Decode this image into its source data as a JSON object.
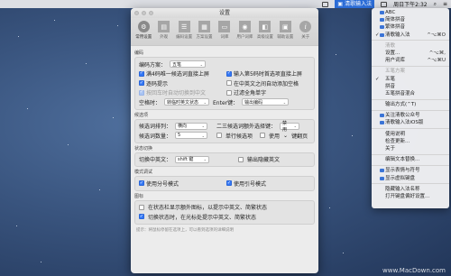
{
  "menubar": {
    "ime_label": "清歌输入法",
    "datetime": "周日下午2:32"
  },
  "window": {
    "title": "设置",
    "toolbar": [
      {
        "label": "常用设置",
        "icon": "gear-icon"
      },
      {
        "label": "外观",
        "icon": "book-icon"
      },
      {
        "label": "编码设置",
        "icon": "list-icon"
      },
      {
        "label": "方案设置",
        "icon": "grid-icon"
      },
      {
        "label": "词库",
        "icon": "words-icon"
      },
      {
        "label": "用户词库",
        "icon": "user-icon"
      },
      {
        "label": "高级设置",
        "icon": "advanced-icon"
      },
      {
        "label": "辅助设置",
        "icon": "gift-icon"
      },
      {
        "label": "关于",
        "icon": "info-icon"
      }
    ],
    "sections": {
      "encoding": {
        "title": "编码",
        "scheme_label": "编码方案：",
        "scheme_value": "五笔",
        "opt1": "满4码唯一候选词直接上屏",
        "opt2": "输入第5码时首选项直接上屏",
        "opt3": "逐码提示",
        "opt4": "在中英文之间自动添加空格",
        "opt5": "按回车时自动切换到中文",
        "opt6": "过滤全角单字",
        "space_label": "空格时：",
        "space_value": "转临时英文状态",
        "enter_label": "Enter键：",
        "enter_value": "输出编码"
      },
      "candidates": {
        "title": "候选项",
        "arrange_label": "候选词排列：",
        "arrange_value": "横向",
        "second_label": "二三候选词额外选择键：",
        "second_value": "禁用",
        "count_label": "候选词数量：",
        "count_value": "5",
        "single_row": "单行候选项",
        "use_label": "使用",
        "use_suffix": "键翻页"
      },
      "state": {
        "title": "状态切换",
        "switch_label": "切换中英文：",
        "switch_value": "shift 键",
        "hidden_english": "输出隐藏英文"
      },
      "mode": {
        "title": "模式调试",
        "opt1": "使用分号模式",
        "opt2": "使用引号模式"
      },
      "icon": {
        "title": "图标",
        "opt1": "在状态栏显示额外图标，以提示中英文、简繁状态",
        "opt2": "切换状态时，在光标处提示中英文、简繁状态"
      }
    },
    "footer": "提示：将鼠标停留在选项上，可以看到选项的详细说明"
  },
  "menu": {
    "items": [
      {
        "label": "ABC",
        "checked": false
      },
      {
        "label": "简体拼音",
        "checked": false
      },
      {
        "label": "繁体拼音",
        "checked": false
      },
      {
        "label": "清歌输入法",
        "checked": true,
        "shortcut": "^⌥⌘O"
      }
    ],
    "section_header": "清歌",
    "settings": {
      "label": "设置...",
      "shortcut": "^⌥⌘,"
    },
    "user_dict": {
      "label": "用户词库",
      "shortcut": "^⌥⌘U"
    },
    "mode_header": "五笔方案",
    "modes": [
      {
        "label": "五笔",
        "checked": true
      },
      {
        "label": "拼音",
        "checked": false
      },
      {
        "label": "五笔拼音混合",
        "checked": false
      }
    ],
    "output": {
      "label": "输出方式",
      "shortcut": "(⌃T)"
    },
    "promo1": "关注清歌公众号",
    "promo2": "清歌输入法iOS版",
    "help1": "使用说明",
    "help2": "检查更新...",
    "help3": "关于",
    "edit_text": "编辑文本替换...",
    "show_emoji": "显示表情与符号",
    "show_keyboard": "显示虚拟键盘",
    "hide_name": "隐藏输入法名称",
    "keyboard_prefs": "打开键盘偏好设置..."
  },
  "watermark": "www.MacDown.com"
}
